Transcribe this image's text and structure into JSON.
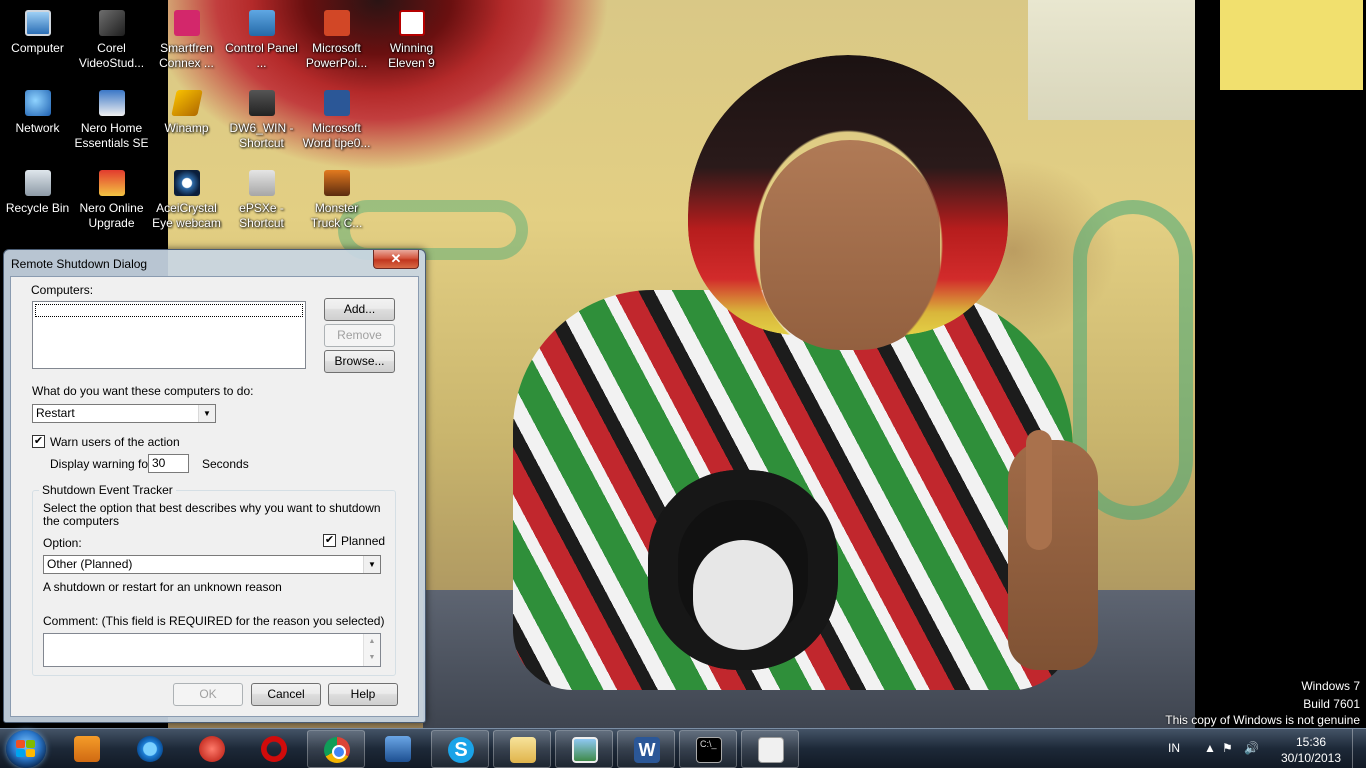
{
  "desktop": {
    "icons": [
      {
        "label": "Computer",
        "icon": "computer-icon"
      },
      {
        "label": "Corel VideoStud...",
        "icon": "corel-videostudio-icon"
      },
      {
        "label": "Smartfren Connex ...",
        "icon": "smartfren-connex-icon"
      },
      {
        "label": "Control Panel ...",
        "icon": "control-panel-icon"
      },
      {
        "label": "Microsoft PowerPoi...",
        "icon": "powerpoint-icon"
      },
      {
        "label": "Winning Eleven 9",
        "icon": "winning-eleven-icon"
      },
      {
        "label": "Network",
        "icon": "network-icon"
      },
      {
        "label": "Nero Home Essentials SE",
        "icon": "nero-home-icon"
      },
      {
        "label": "Winamp",
        "icon": "winamp-icon"
      },
      {
        "label": "DW6_WIN - Shortcut",
        "icon": "dw6-shortcut-icon"
      },
      {
        "label": "Microsoft Word tipe0...",
        "icon": "word-document-icon"
      },
      {
        "label": "Recycle Bin",
        "icon": "recycle-bin-icon"
      },
      {
        "label": "Nero Online Upgrade",
        "icon": "nero-online-upgrade-icon"
      },
      {
        "label": "AceiCrystal Eye webcam",
        "icon": "webcam-icon"
      },
      {
        "label": "ePSXe - Shortcut",
        "icon": "epsxe-shortcut-icon"
      },
      {
        "label": "Monster Truck C...",
        "icon": "monster-truck-icon"
      }
    ]
  },
  "dialog": {
    "title": "Remote Shutdown Dialog",
    "close_label": "✕",
    "computers_label": "Computers:",
    "add_button": "Add...",
    "remove_button": "Remove",
    "browse_button": "Browse...",
    "action_question": "What do you want these computers to do:",
    "action_selected": "Restart",
    "warn_checkbox_label": "Warn users of the action",
    "warn_checked": true,
    "display_warning_label": "Display warning for",
    "warning_seconds": "30",
    "seconds_label": "Seconds",
    "tracker": {
      "legend": "Shutdown Event Tracker",
      "description": "Select the option that best describes why you want to shutdown the computers",
      "planned_label": "Planned",
      "planned_checked": true,
      "option_label": "Option:",
      "option_selected": "Other (Planned)",
      "option_description": "A shutdown or restart for an unknown reason",
      "comment_label": "Comment: (This field is REQUIRED for the reason you selected)",
      "comment_value": ""
    },
    "ok_button": "OK",
    "cancel_button": "Cancel",
    "help_button": "Help"
  },
  "watermark": {
    "line1": "Windows 7",
    "line2": "Build 7601",
    "line3": "This copy of Windows is not genuine"
  },
  "taskbar": {
    "pinned": [
      {
        "icon": "windows-media-player-icon"
      },
      {
        "icon": "internet-explorer-icon"
      },
      {
        "icon": "red-hand-app-icon"
      },
      {
        "icon": "opera-icon"
      },
      {
        "icon": "chrome-icon"
      },
      {
        "icon": "x-app-icon"
      },
      {
        "icon": "skype-icon"
      },
      {
        "icon": "windows-explorer-icon"
      },
      {
        "icon": "photo-viewer-icon"
      },
      {
        "icon": "word-icon"
      },
      {
        "icon": "command-prompt-icon"
      },
      {
        "icon": "remote-shutdown-icon"
      }
    ],
    "language": "IN",
    "time": "15:36",
    "date": "30/10/2013"
  }
}
